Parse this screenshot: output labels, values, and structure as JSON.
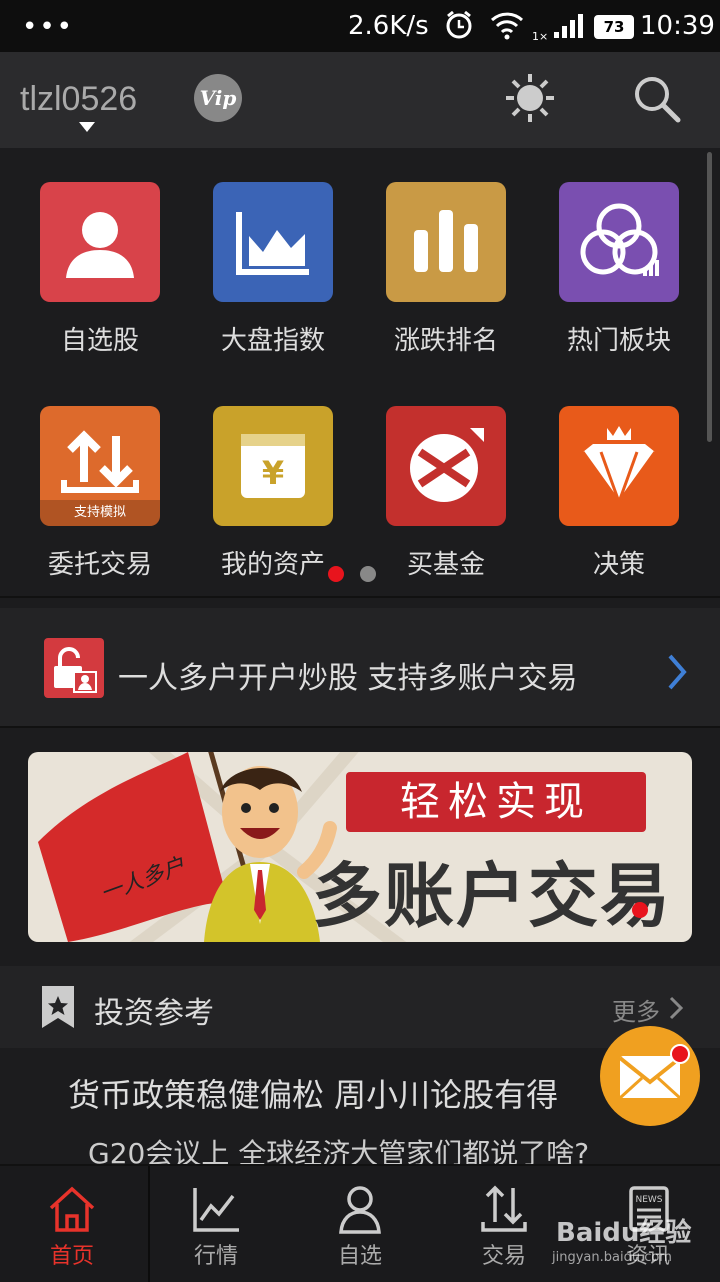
{
  "status_bar": {
    "dots": "•••",
    "speed": "2.6K/s",
    "battery": "73",
    "time": "10:39"
  },
  "header": {
    "username": "tlzl0526",
    "vip": "Vip"
  },
  "grid_items": [
    {
      "label": "自选股",
      "color": "#d8434a",
      "icon": "person-icon"
    },
    {
      "label": "大盘指数",
      "color": "#3b64b6",
      "icon": "area-chart-icon"
    },
    {
      "label": "涨跌排名",
      "color": "#c99a45",
      "icon": "bar-chart-icon"
    },
    {
      "label": "热门板块",
      "color": "#7a4fb0",
      "icon": "circles-icon"
    },
    {
      "label": "委托交易",
      "color": "#dd6a2c",
      "icon": "trade-arrows-icon",
      "tag": "支持模拟"
    },
    {
      "label": "我的资产",
      "color": "#c9a22a",
      "icon": "yen-wallet-icon"
    },
    {
      "label": "买基金",
      "color": "#c3302d",
      "icon": "fund-icon"
    },
    {
      "label": "决策",
      "color": "#e85a1a",
      "icon": "diamond-icon"
    }
  ],
  "pager": {
    "pages": 2,
    "active": 1
  },
  "promo": {
    "text": "一人多户开户炒股  支持多账户交易"
  },
  "banner": {
    "ribbon": "轻松实现",
    "headline": "多账户交易",
    "flag_text": "一人多户"
  },
  "section": {
    "title": "投资参考",
    "more": "更多"
  },
  "news": [
    "货币政策稳健偏松 周小川论股有得",
    "G20会议上 全球经济大管家们都说了啥?"
  ],
  "tabs": [
    {
      "label": "首页",
      "icon": "home-icon",
      "active": true
    },
    {
      "label": "行情",
      "icon": "line-chart-icon",
      "active": false
    },
    {
      "label": "自选",
      "icon": "user-icon",
      "active": false
    },
    {
      "label": "交易",
      "icon": "transfer-icon",
      "active": false
    },
    {
      "label": "资讯",
      "icon": "news-icon",
      "active": false
    }
  ],
  "watermark": {
    "brand": "Baidu经验",
    "url": "jingyan.baidu.com"
  },
  "colors": {
    "accent": "#e8332b",
    "background": "#1c1c1e"
  }
}
